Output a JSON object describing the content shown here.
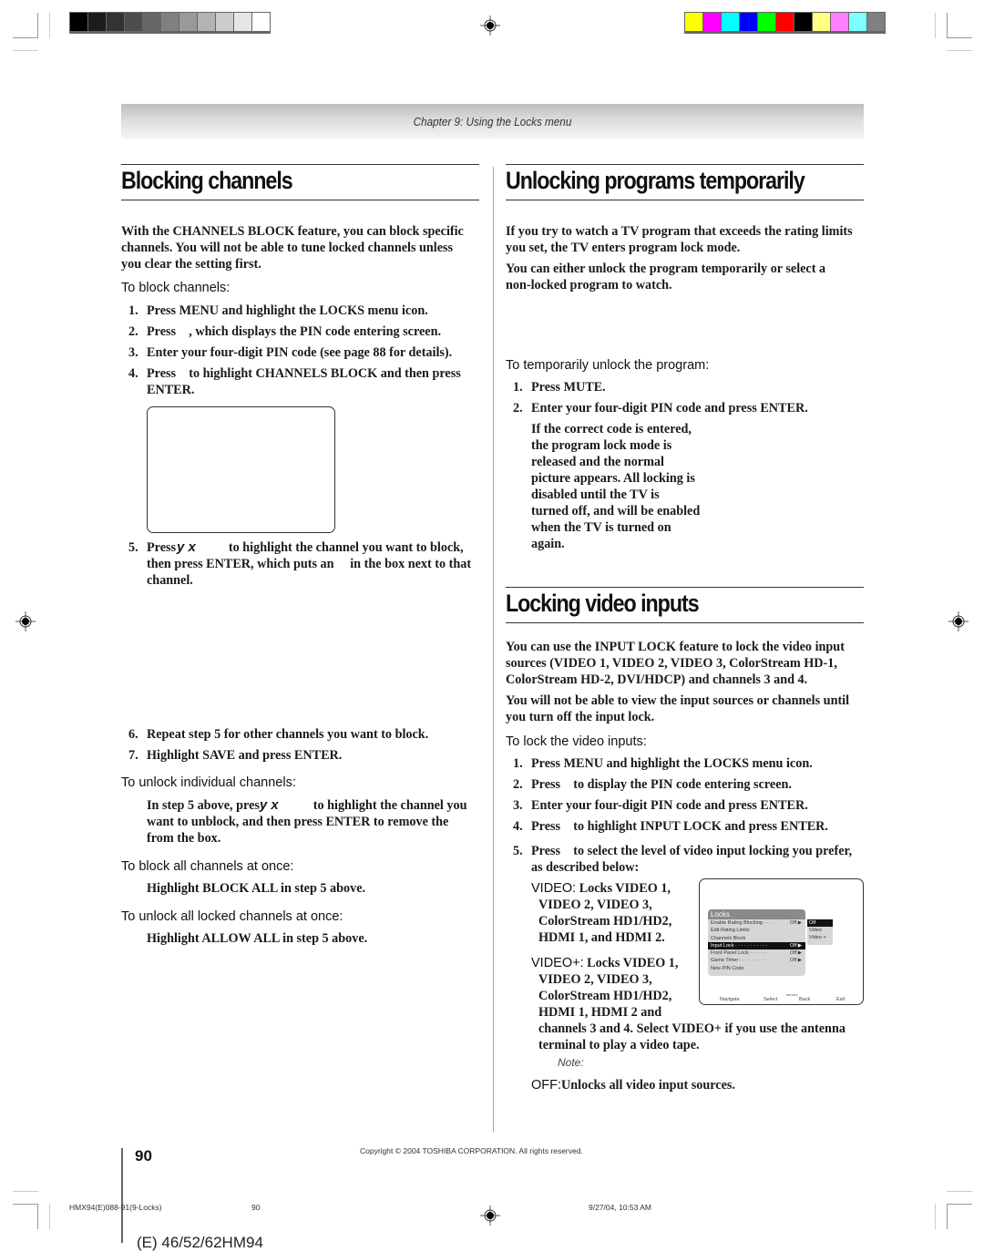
{
  "print_marks": {
    "gray_swatches": [
      "#000000",
      "#1c1c1c",
      "#333333",
      "#4d4d4d",
      "#666666",
      "#808080",
      "#999999",
      "#b3b3b3",
      "#cccccc",
      "#e6e6e6",
      "#ffffff"
    ],
    "color_swatches": [
      "#ffff00",
      "#ff00ff",
      "#00ffff",
      "#0000ff",
      "#00ff00",
      "#ff0000",
      "#000000",
      "#ffff80",
      "#ff80ff",
      "#80ffff",
      "#808080"
    ]
  },
  "header": {
    "chapter": "Chapter 9: Using the Locks menu"
  },
  "left": {
    "title": "Blocking channels",
    "intro": [
      "With the CHANNELS BLOCK feature, you can block specific",
      "channels. You will not be able to tune locked channels unless",
      "you clear the setting first."
    ],
    "block_heading": "To block channels:",
    "steps": [
      {
        "n": "1.",
        "lines": [
          "Press MENU and highlight the LOCKS menu icon."
        ]
      },
      {
        "n": "2.",
        "lines": [
          "Press    , which displays the PIN code entering screen."
        ]
      },
      {
        "n": "3.",
        "lines": [
          "Enter your four-digit PIN code (see page 88 for details)."
        ]
      },
      {
        "n": "4.",
        "lines": [
          "Press    to highlight CHANNELS BLOCK and then press",
          "ENTER."
        ]
      },
      {
        "n": "5.",
        "lines": [
          "Press",
          "to highlight the channel you want to block,",
          "then press ENTER, which puts an     in the box next to that",
          "channel."
        ],
        "arrows": "y x"
      },
      {
        "n": "6.",
        "lines": [
          "Repeat step 5 for other channels you want to block."
        ]
      },
      {
        "n": "7.",
        "lines": [
          "Highlight SAVE and press ENTER."
        ]
      }
    ],
    "unlock_individual": {
      "heading": "To unlock individual channels:",
      "lines": [
        "In step 5 above, pres",
        "to highlight the channel you",
        "want to unblock, and then press ENTER to remove the",
        "from the box."
      ],
      "arrows": "y x"
    },
    "block_all": {
      "heading": "To block all channels at once:",
      "text": "Highlight BLOCK ALL in step 5 above."
    },
    "unlock_all": {
      "heading": "To unlock all locked channels at once:",
      "text": "Highlight ALLOW ALL in step 5 above."
    }
  },
  "right": {
    "title1": "Unlocking programs temporarily",
    "intro1": [
      "If you try to watch a TV program that exceeds the rating limits",
      "you set, the TV enters program lock mode."
    ],
    "intro2": [
      "You can either unlock the program temporarily or select a",
      "non-locked program to watch."
    ],
    "temp_heading": "To temporarily unlock the program:",
    "temp_steps": [
      {
        "n": "1.",
        "text": "Press MUTE."
      },
      {
        "n": "2.",
        "text": "Enter your four-digit PIN code and press ENTER."
      }
    ],
    "temp_note": [
      "If the correct code is entered,",
      "the program lock mode is",
      "released and the normal",
      "picture appears. All locking is",
      "disabled until the TV is",
      "turned off, and will be enabled",
      "when the TV is turned on",
      "again."
    ],
    "title2": "Locking video inputs",
    "intro3": [
      "You can use the INPUT LOCK feature to lock the video input",
      "sources (VIDEO 1, VIDEO 2, VIDEO 3, ColorStream HD-1,",
      "ColorStream HD-2, DVI/HDCP) and channels 3 and 4."
    ],
    "intro4": [
      "You will not be able to view the input sources or channels until",
      "you turn off the input lock."
    ],
    "lock_heading": "To lock the video inputs:",
    "lock_steps": [
      {
        "n": "1.",
        "lines": [
          "Press MENU and highlight the LOCKS menu icon."
        ]
      },
      {
        "n": "2.",
        "lines": [
          "Press    to display the PIN code entering screen."
        ]
      },
      {
        "n": "3.",
        "lines": [
          "Enter your four-digit PIN code and press ENTER."
        ]
      },
      {
        "n": "4.",
        "lines": [
          "Press    to highlight INPUT LOCK and press ENTER."
        ]
      },
      {
        "n": "5.",
        "lines": [
          "Press    to select the level of video input locking you prefer,",
          "as described below:"
        ]
      }
    ],
    "video": {
      "label": "VIDEO:",
      "lines": [
        "Locks VIDEO 1,",
        "VIDEO 2, VIDEO 3,",
        "ColorStream HD1/HD2,",
        "HDMI 1, and HDMI 2."
      ]
    },
    "videoplus": {
      "label": "VIDEO+:",
      "lines": [
        "Locks VIDEO 1,",
        "VIDEO 2, VIDEO 3,",
        "ColorStream HD1/HD2,",
        "HDMI 1, HDMI 2 and",
        "channels 3 and 4. Select VIDEO+ if you use the antenna",
        "terminal to play a video tape."
      ]
    },
    "note": "Note:",
    "off": {
      "label": "OFF:",
      "text": "Unlocks all video input sources."
    }
  },
  "locks_screen": {
    "title": "Locks",
    "rows": [
      {
        "label": "Enable Rating Blocking · · ·",
        "value": "Off ▶",
        "highlighted": false
      },
      {
        "label": "Edit Rating Limits",
        "value": "",
        "highlighted": false
      },
      {
        "label": "Channels Block",
        "value": "",
        "highlighted": false
      },
      {
        "label": "Input Lock · · · · · · · · · · ·",
        "value": "Off ▶",
        "highlighted": true
      },
      {
        "label": "Front Panel Lock · · · · · ·",
        "value": "Off ▶",
        "highlighted": false
      },
      {
        "label": "Game Timer · · · · · · · · ·",
        "value": "Off ▶",
        "highlighted": false
      },
      {
        "label": "New PIN Code",
        "value": "",
        "highlighted": false
      }
    ],
    "options": [
      "Off",
      "Video",
      "Video +"
    ],
    "selected_option": "Off",
    "footer": {
      "navigate": "Navigate",
      "select": "Select",
      "back_small": "RETURN",
      "back": "Back",
      "exit": "Exit"
    }
  },
  "footer": {
    "page_number": "90",
    "copyright": "Copyright © 2004 TOSHIBA CORPORATION. All rights reserved.",
    "slug_file": "HMX94(E)088-91(9-Locks)",
    "slug_page": "90",
    "slug_date": "9/27/04, 10:53 AM",
    "model": "(E) 46/52/62HM94"
  }
}
